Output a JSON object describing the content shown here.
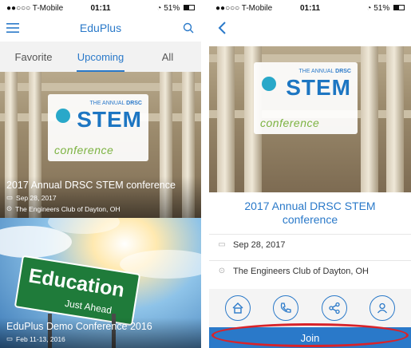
{
  "left": {
    "status": {
      "carrier": "●●○○○ T-Mobile",
      "time": "01:11",
      "battery": "51%"
    },
    "nav": {
      "title": "EduPlus",
      "menu_icon": "hamburger-menu-icon",
      "search_icon": "search-icon"
    },
    "tabs": [
      {
        "label": "Favorite"
      },
      {
        "label": "Upcoming"
      },
      {
        "label": "All"
      }
    ],
    "active_tab": "Upcoming",
    "cards": [
      {
        "title": "2017 Annual DRSC STEM conference",
        "date": "Sep 28, 2017",
        "location": "The Engineers Club of Dayton, OH",
        "logo": {
          "annual_prefix": "THE ANNUAL",
          "annual_org": "DRSC",
          "main": "STEM",
          "sub": "conference"
        }
      },
      {
        "title": "EduPlus Demo Conference 2016",
        "date": "Feb 11-13, 2016",
        "sign": {
          "main": "Education",
          "sub": "Just Ahead"
        }
      }
    ]
  },
  "right": {
    "status": {
      "carrier": "●●○○○ T-Mobile",
      "time": "01:11",
      "battery": "51%"
    },
    "nav": {
      "back_icon": "chevron-left-icon"
    },
    "logo": {
      "annual_prefix": "THE ANNUAL",
      "annual_org": "DRSC",
      "main": "STEM",
      "sub": "conference"
    },
    "event": {
      "title": "2017 Annual DRSC STEM conference",
      "date": "Sep 28, 2017",
      "location": "The Engineers Club of Dayton, OH"
    },
    "actions": [
      "home-icon",
      "phone-icon",
      "share-icon",
      "user-icon"
    ],
    "join_label": "Join"
  },
  "colors": {
    "accent": "#2a79c9",
    "highlight_ring": "#d8232a",
    "tab_bar": "#f2f2f2"
  }
}
